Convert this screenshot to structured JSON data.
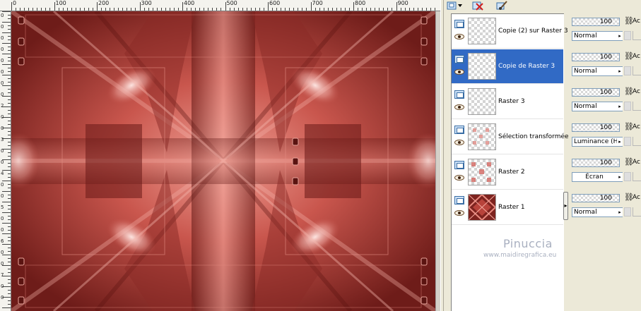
{
  "ruler": {
    "top_labels": [
      "0",
      "100",
      "200",
      "300",
      "400",
      "500",
      "600",
      "700",
      "800",
      "900"
    ],
    "left_labels": [
      "0",
      "0",
      "0",
      "0",
      "0",
      "0",
      "0",
      "0",
      "2",
      "0",
      "0",
      "3",
      "0",
      "0",
      "4",
      "0",
      "0",
      "5",
      "0",
      "0",
      "6",
      "0",
      "0",
      "7",
      "0",
      "0"
    ]
  },
  "toolbar": {
    "new_layer_icon": "layer-add-icon",
    "delete_layer_icon": "layer-delete-icon",
    "brush_icon": "paintbrush-icon"
  },
  "layers": [
    {
      "name": "Copie (2) sur Raster 3",
      "opacity": "100",
      "blend": "Normal",
      "thumb": "transparent",
      "selected": false,
      "prop_label": "Ac"
    },
    {
      "name": "Copie de Raster 3",
      "opacity": "100",
      "blend": "Normal",
      "thumb": "transparent",
      "selected": true,
      "prop_label": "Ac"
    },
    {
      "name": "Raster 3",
      "opacity": "100",
      "blend": "Normal",
      "thumb": "transparent",
      "selected": false,
      "prop_label": "Ac"
    },
    {
      "name": "Sélection transformée",
      "opacity": "100",
      "blend": "Luminance (H)",
      "thumb": "transparent-pattern",
      "selected": false,
      "prop_label": "Ac"
    },
    {
      "name": "Raster 2",
      "opacity": "100",
      "blend": "Écran",
      "thumb": "transparent-pattern",
      "selected": false,
      "prop_label": "Ac"
    },
    {
      "name": "Raster 1",
      "opacity": "100",
      "blend": "Normal",
      "thumb": "red-kaleido",
      "selected": false,
      "prop_label": "Ac"
    }
  ],
  "watermark": {
    "name": "Pinuccia",
    "url": "www.maidiregrafica.eu"
  },
  "colors": {
    "canvas_dark": "#7a2320",
    "canvas_mid": "#c4524a",
    "canvas_light": "#f3a9a0",
    "selection": "#316ac5"
  }
}
